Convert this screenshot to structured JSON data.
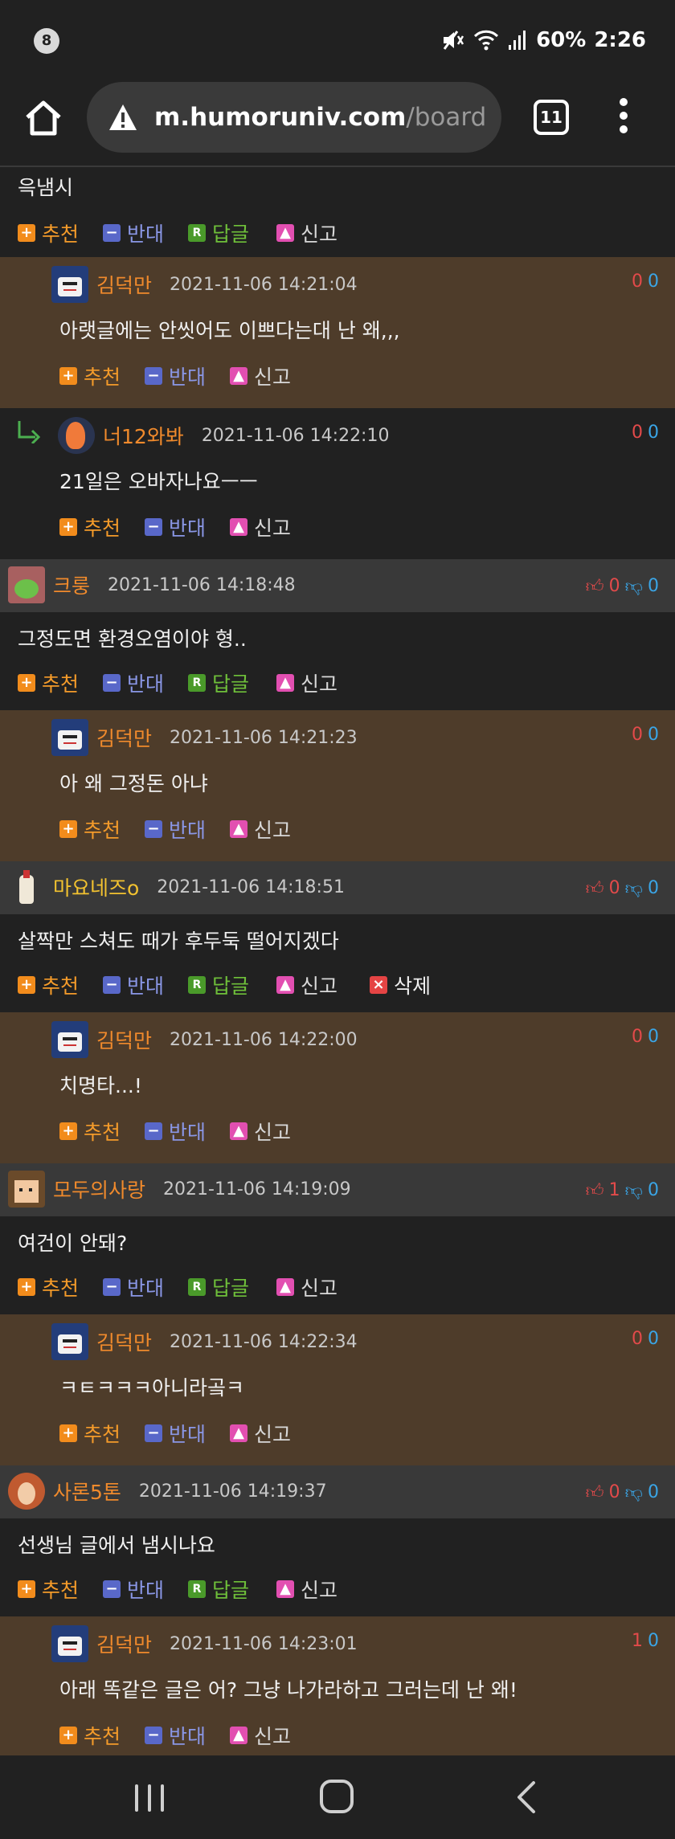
{
  "status_bar": {
    "notification_count": "8",
    "battery": "60%",
    "time": "2:26"
  },
  "browser": {
    "url_host": "m.humoruniv.com",
    "url_path": "/board",
    "tab_count": "11"
  },
  "actions": {
    "recommend": "추천",
    "oppose": "반대",
    "reply": "답글",
    "report": "신고",
    "delete": "삭제"
  },
  "comments": [
    {
      "type": "partial",
      "text": "윽냄시"
    },
    {
      "type": "reply",
      "user": "김덕만",
      "date": "2021-11-06 14:21:04",
      "up": "0",
      "down": "0",
      "text": "아랫글에는 안씻어도 이쁘다는대 난 왜,,,"
    },
    {
      "type": "reply",
      "user": "너12와봐",
      "date": "2021-11-06 14:22:10",
      "up": "0",
      "down": "0",
      "text": "21일은 오바자나요ㅡㅡ"
    },
    {
      "type": "top",
      "user": "크룽",
      "date": "2021-11-06 14:18:48",
      "up": "0",
      "down": "0",
      "text": "그정도면 환경오염이야 형.."
    },
    {
      "type": "reply",
      "user": "김덕만",
      "date": "2021-11-06 14:21:23",
      "up": "0",
      "down": "0",
      "text": "아 왜 그정돈 아냐"
    },
    {
      "type": "top",
      "user": "마요네즈o",
      "date": "2021-11-06 14:18:51",
      "up": "0",
      "down": "0",
      "text": "살짝만 스쳐도 때가 후두둑 떨어지겠다"
    },
    {
      "type": "reply",
      "user": "김덕만",
      "date": "2021-11-06 14:22:00",
      "up": "0",
      "down": "0",
      "text": "치명타...!"
    },
    {
      "type": "top",
      "user": "모두의사랑",
      "date": "2021-11-06 14:19:09",
      "up": "1",
      "down": "0",
      "text": "여건이 안돼?"
    },
    {
      "type": "reply",
      "user": "김덕만",
      "date": "2021-11-06 14:22:34",
      "up": "0",
      "down": "0",
      "text": "ㅋㅌㅋㅋㅋ아니라곸ㅋ"
    },
    {
      "type": "top",
      "user": "사론5톤",
      "date": "2021-11-06 14:19:37",
      "up": "0",
      "down": "0",
      "text": "선생님 글에서 냄시나요"
    },
    {
      "type": "reply",
      "user": "김덕만",
      "date": "2021-11-06 14:23:01",
      "up": "1",
      "down": "0",
      "text": "아래 똑같은 글은 어? 그냥 나가라하고 그러는데 난 왜!"
    }
  ]
}
